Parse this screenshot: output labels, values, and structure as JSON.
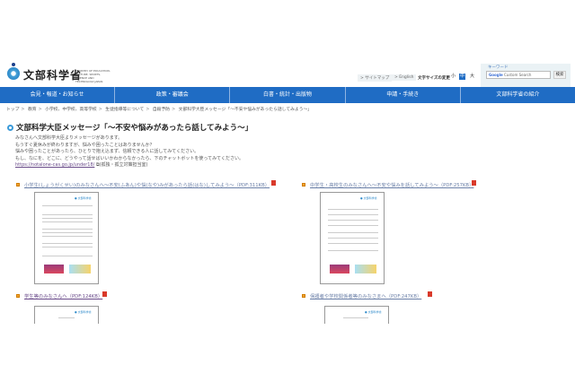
{
  "header": {
    "logo_text": "文部科学省",
    "logo_en": "MINISTRY OF EDUCATION, CULTURE, SPORTS, SCIENCE AND TECHNOLOGY-JAPAN",
    "sitemap": "> サイトマップ",
    "english": "> English",
    "font_size_label": "文字サイズの変更",
    "font_small": "小",
    "font_medium": "中",
    "font_large": "大",
    "search_label": "キーワード",
    "search_placeholder": "Custom Search",
    "google": "Google",
    "search_button": "検索"
  },
  "nav": [
    "会見・報道・お知らせ",
    "政策・審議会",
    "白書・統計・出版物",
    "申請・手続き",
    "文部科学省の紹介"
  ],
  "breadcrumb": [
    "トップ",
    "教育",
    "小学校、中学校、高等学校",
    "生徒指導等について",
    "自殺予防",
    "文部科学大臣メッセージ「～不安や悩みがあったら話してみよう～」"
  ],
  "title": "文部科学大臣メッセージ「～不安や悩みがあったら話してみよう～」",
  "body": [
    "みなさんへ文部科学大臣よりメッセージがあります。",
    "もうすぐ夏休みが終わりますが、悩みや困ったことはありませんか？",
    "悩みや困ったことがあったら、ひとりで抱え込まず、信頼できる人に話してみてください。",
    "もし、なにを、どこに、どうやって話せばいいかわからなかったら、下のチャットボットを使ってみてください。"
  ],
  "link_url": "https://notalone-cas.go.jp/under18/",
  "link_note": "(孤独・孤立対策担当室)",
  "documents": [
    {
      "label": "小学生(しょうがくせい)のみなさんへ～不安(ふあん)や悩(なや)みがあったら話(はな)してみよう～（PDF:311KB）"
    },
    {
      "label": "中学生・高校生のみなさんへ～不安や悩みを話してみよう～（PDF:257KB）"
    },
    {
      "label": "学生等のみなさんへ（PDF:124KB）"
    },
    {
      "label": "保護者や学校関係者等のみなさまへ（PDF:247KB）"
    }
  ],
  "pdf_icon": "PDF",
  "thumb_logo": "文部科学省",
  "colors": {
    "nav": "#1f6cc4",
    "bullet": "#f0a430",
    "pdf": "#d93a2b"
  }
}
